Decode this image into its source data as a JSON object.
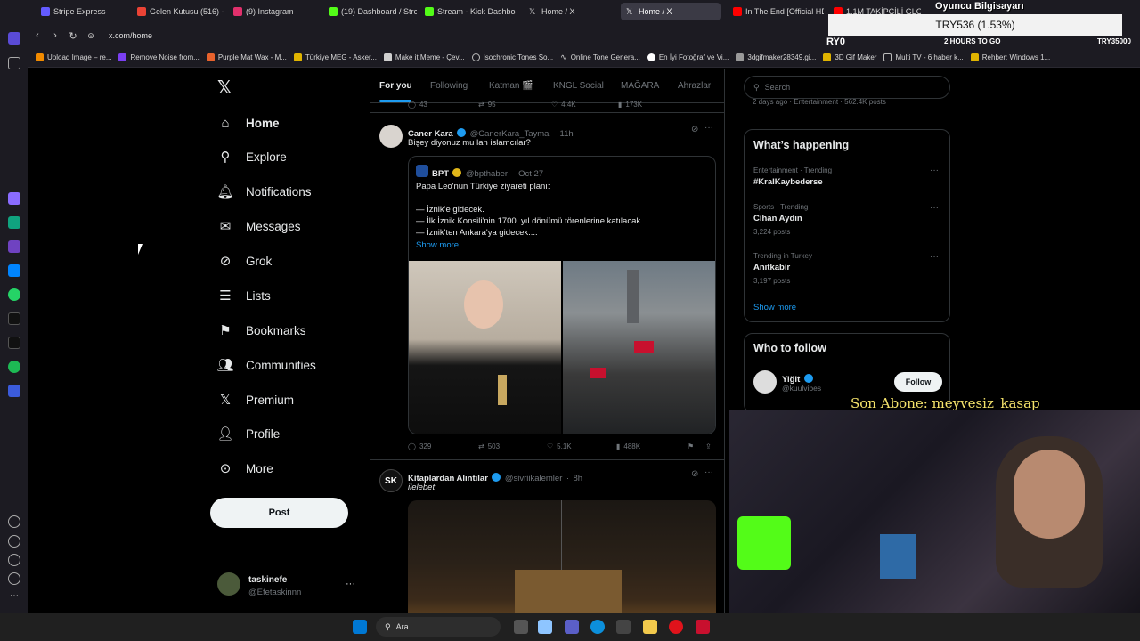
{
  "browser": {
    "tabs": [
      {
        "label": "Stripe Express",
        "color": "#635bff"
      },
      {
        "label": "Gelen Kutusu (516) - no",
        "color": "#ea4335"
      },
      {
        "label": "(9) Instagram",
        "color": "#e1306c"
      },
      {
        "label": "(19) Dashboard / Stream",
        "color": "#53fc18"
      },
      {
        "label": "Stream - Kick Dashboar",
        "color": "#53fc18"
      },
      {
        "label": "Home / X",
        "color": "#ffffff"
      },
      {
        "label": "Home / X",
        "color": "#ffffff"
      },
      {
        "label": "In The End [Official HD",
        "color": "#ff0000"
      },
      {
        "label": "1.1M TAKİPÇİLİ GLOBAL",
        "color": "#ff0000"
      }
    ],
    "url": "x.com/home",
    "bookmarks": [
      "Upload Image – re...",
      "Remove Noise from...",
      "Purple Mat Wax - M...",
      "Türkiye MEG - Asker...",
      "Make it Meme - Çev...",
      "Isochronic Tones So...",
      "Online Tone Genera...",
      "En İyi Fotoğraf ve Vi...",
      "3dgifmaker28349.gi...",
      "3D Gif Maker",
      "Multi TV - 6 haber k...",
      "Rehber: Windows 1..."
    ]
  },
  "nav": {
    "items": [
      {
        "label": "Home",
        "icon": "home-icon"
      },
      {
        "label": "Explore",
        "icon": "search-icon"
      },
      {
        "label": "Notifications",
        "icon": "bell-icon"
      },
      {
        "label": "Messages",
        "icon": "mail-icon"
      },
      {
        "label": "Grok",
        "icon": "grok-icon"
      },
      {
        "label": "Lists",
        "icon": "list-icon"
      },
      {
        "label": "Bookmarks",
        "icon": "bookmark-icon"
      },
      {
        "label": "Communities",
        "icon": "people-icon"
      },
      {
        "label": "Premium",
        "icon": "x-logo-icon"
      },
      {
        "label": "Profile",
        "icon": "person-icon"
      },
      {
        "label": "More",
        "icon": "more-circle-icon"
      }
    ],
    "post_label": "Post",
    "account": {
      "name": "taskinefe",
      "handle": "@Efetaskinnn"
    }
  },
  "timeline": {
    "tabs": [
      "For you",
      "Following",
      "Katman 🎬",
      "KNGL Social",
      "MAĞARA",
      "Ahrazlar"
    ],
    "prev_actions": {
      "replies": "43",
      "reposts": "95",
      "likes": "4.4K",
      "views": "173K"
    },
    "tweet1": {
      "name": "Caner Kara",
      "handle": "@CanerKara_Tayma",
      "time": "11h",
      "text": "Bişey diyonuz mu lan islamcılar?",
      "quote": {
        "name": "BPT",
        "handle": "@bpthaber",
        "time": "Oct 27",
        "line1": "Papa Leo'nun Türkiye ziyareti planı:",
        "line2": "— İznik'e gidecek.",
        "line3": "— İlk İznik Konsili'nin 1700. yıl dönümü törenlerine katılacak.",
        "line4": "— İznik'ten Ankara'ya gidecek....",
        "show_more": "Show more"
      },
      "replies": "329",
      "reposts": "503",
      "likes": "5.1K",
      "views": "488K"
    },
    "tweet2": {
      "name": "Kitaplardan Alıntılar",
      "handle": "@sivriikalemler",
      "time": "8h",
      "text": "ilelebet"
    }
  },
  "right": {
    "search_placeholder": "Search",
    "top_snippet": "2 days ago · Entertainment · 562.4K posts",
    "whats_happening": "What’s happening",
    "trends": [
      {
        "category": "Entertainment · Trending",
        "name": "#KralKaybederse",
        "posts": ""
      },
      {
        "category": "Sports · Trending",
        "name": "Cihan Aydın",
        "posts": "3,224 posts"
      },
      {
        "category": "Trending in Turkey",
        "name": "Anıtkabir",
        "posts": "3,197 posts"
      }
    ],
    "show_more": "Show more",
    "who_to_follow": "Who to follow",
    "follow": {
      "name": "Yiğit",
      "handle": "@kuulvibes",
      "button": "Follow"
    }
  },
  "overlay": {
    "ticker": "TRY536 (1.53%)",
    "stream_title": "Oyuncu Bilgisayarı",
    "goal": "2 HOURS TO GO",
    "code_left": "RY0",
    "code_right": "TRY35000",
    "subscriber": "Son Abone: meyvesiz_kasap"
  },
  "taskbar": {
    "search": "Ara"
  },
  "colors": {
    "accent": "#1d9bf0",
    "bg": "#000000",
    "border": "#2f3336",
    "muted": "#71767b"
  }
}
